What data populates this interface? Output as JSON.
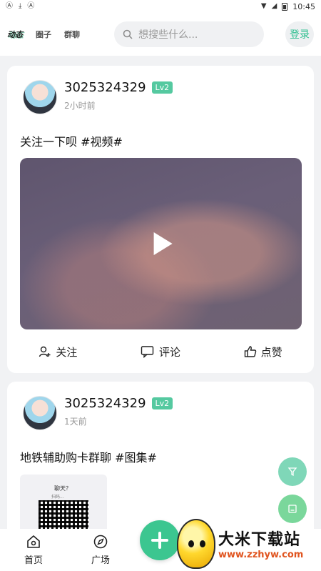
{
  "status_bar": {
    "left_icons": [
      "A",
      "download",
      "A"
    ],
    "time": "10:45"
  },
  "header": {
    "tabs": [
      {
        "label": "动态"
      },
      {
        "label": "圈子"
      },
      {
        "label": "群聊"
      }
    ],
    "search_placeholder": "想搜些什么...",
    "login_label": "登录",
    "accent_color": "#3cc690"
  },
  "feed": [
    {
      "username": "3025324329",
      "level": "Lv2",
      "time": "2小时前",
      "text": "关注一下呗 #视频#",
      "actions": {
        "follow": "关注",
        "comment": "评论",
        "like": "点赞"
      }
    },
    {
      "username": "3025324329",
      "level": "Lv2",
      "time": "1天前",
      "text": "地铁辅助购卡群聊 #图集#",
      "thumb_title": "聊天？",
      "thumb_sub": "扫码..."
    }
  ],
  "bottom_nav": {
    "home": "首页",
    "square": "广场"
  },
  "watermark": {
    "title": "大米下载站",
    "url": "www.zzhyw.com"
  }
}
